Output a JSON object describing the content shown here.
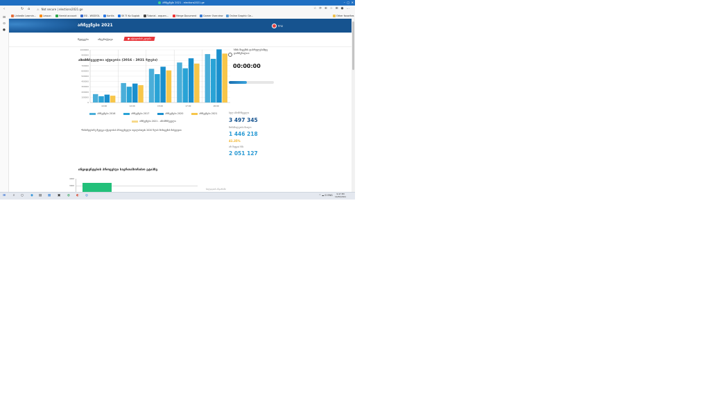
{
  "browser": {
    "tab_title": "არჩევნები 2021 - elections2021.ge",
    "security_label": "Not secure",
    "url": "elections2021.ge",
    "bookmarks": [
      "LinkedIn Learnin...",
      "Lesson",
      "Hamid account",
      "ESI - WSSEOL",
      "Kartlis",
      "SK Ti Ko Sugiob",
      "Tutorial - arguen...",
      "Merge Document",
      "Gamer Overview",
      "Online Graphic Ge...",
      "Other favorites"
    ]
  },
  "banner": {
    "title": "არჩევნები 2021",
    "language": "Eng"
  },
  "menu": {
    "items": [
      "შედეგები",
      "ინტერაქტივი",
      "● აქტივობის კლება"
    ]
  },
  "chart_section": {
    "title": "ამომრჩეველთა აქტივობა (2016 - 2021 წლები)",
    "footnote": "*წინამდებარე შედეგი აქტივობის პროცენტული თვალისთვის 2020 წლის მონაცემის მიხედვით"
  },
  "chart_data": {
    "type": "bar",
    "categories": [
      "10:00",
      "12:00",
      "15:00",
      "17:00",
      "20:00"
    ],
    "ylim": [
      0,
      1000000
    ],
    "yticks": [
      "1000000",
      "900000",
      "800000",
      "700000",
      "600000",
      "500000",
      "400000",
      "300000",
      "200000",
      "100000",
      "0"
    ],
    "series": [
      {
        "name": "არჩევნები 2016",
        "color": "#4aaed9",
        "values": [
          160000,
          370000,
          640000,
          760000,
          920000
        ]
      },
      {
        "name": "არჩევნები 2017",
        "color": "#29a3d6",
        "values": [
          120000,
          300000,
          540000,
          650000,
          830000
        ]
      },
      {
        "name": "არჩევნები 2020",
        "color": "#1a8fcd",
        "values": [
          150000,
          360000,
          680000,
          840000,
          1010000
        ]
      },
      {
        "name": "არჩევნები 2021",
        "color": "#f7c64a",
        "values": [
          130000,
          330000,
          610000,
          740000,
          930000
        ]
      }
    ],
    "extra_legend": {
      "name": "არჩევნები 2021 - ამომრჩეველი",
      "color": "#f7d98a"
    },
    "legend_position": "bottom"
  },
  "timer": {
    "label": "ხმის მიცემის დასრულებამდე დარჩენილია:",
    "value": "00:00:00",
    "progress": 0.4
  },
  "stats": [
    {
      "label": "სულ ამომრჩეველი",
      "value": "3 497 345",
      "color": "#16538f"
    },
    {
      "label": "მონაწილეობა მიიღო",
      "value": "1 446 218",
      "color": "#2a9ad4"
    },
    {
      "label": "",
      "value": "41.35%",
      "color": "#f2b01e"
    },
    {
      "label": "არ მიუცია ხმა",
      "value": "2 051 127",
      "color": "#2a9ad4"
    }
  ],
  "section2": {
    "title": "ინციდენტების პროცესუა საერთაშორისო ეტაპზე",
    "ticks": [
      "4000",
      "3000"
    ],
    "note": "სიტუაციის ანგარიში"
  },
  "taskbar": {
    "tray_text": "ENG",
    "time": "9:47 PM",
    "date": "10/30/2021"
  }
}
